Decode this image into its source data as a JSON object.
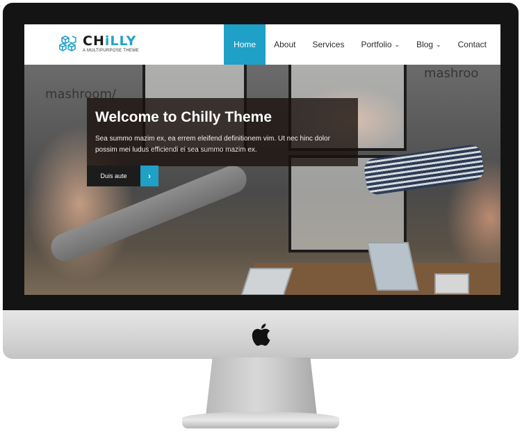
{
  "brand": {
    "name_main": "CH",
    "name_accent": "iLLY",
    "tagline": "A MULTIPURPOSE THEME"
  },
  "nav": {
    "items": [
      {
        "label": "Home",
        "active": true,
        "has_dropdown": false
      },
      {
        "label": "About",
        "active": false,
        "has_dropdown": false
      },
      {
        "label": "Services",
        "active": false,
        "has_dropdown": false
      },
      {
        "label": "Portfolio",
        "active": false,
        "has_dropdown": true
      },
      {
        "label": "Blog",
        "active": false,
        "has_dropdown": true
      },
      {
        "label": "Contact",
        "active": false,
        "has_dropdown": false
      }
    ]
  },
  "hero": {
    "title": "Welcome to Chilly Theme",
    "text": "Sea summo mazim ex, ea errem eleifend definitionem vim. Ut nec hinc dolor possim mei ludus efficiendi ei sea summo mazim ex.",
    "button_label": "Duis aute",
    "button_icon": "chevron-right-icon",
    "sign_left": "mashroom/",
    "sign_right": "mashroo"
  },
  "colors": {
    "accent": "#1fa0c6",
    "overlay": "#18100c",
    "monitor_bezel": "#141414",
    "monitor_chin": "#d3d3d3"
  }
}
